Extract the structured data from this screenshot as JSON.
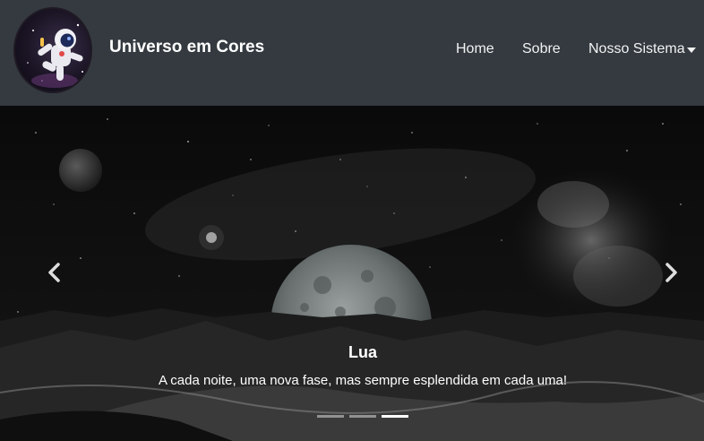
{
  "navbar": {
    "brand": "Universo em Cores",
    "links": [
      {
        "label": "Home"
      },
      {
        "label": "Sobre"
      },
      {
        "label": "Nosso Sistema"
      }
    ]
  },
  "carousel": {
    "slides": [
      {
        "title": "Lua",
        "text": "A cada noite, uma nova fase, mas sempre esplendida em cada uma!"
      }
    ],
    "active_slide": 3,
    "slide_count": 3
  },
  "icons": {
    "logo": "astronaut-logo",
    "prev": "chevron-left-icon",
    "next": "chevron-right-icon",
    "dropdown": "caret-down-icon"
  },
  "colors": {
    "navbar_bg": "#343a40",
    "text": "#ffffff"
  }
}
